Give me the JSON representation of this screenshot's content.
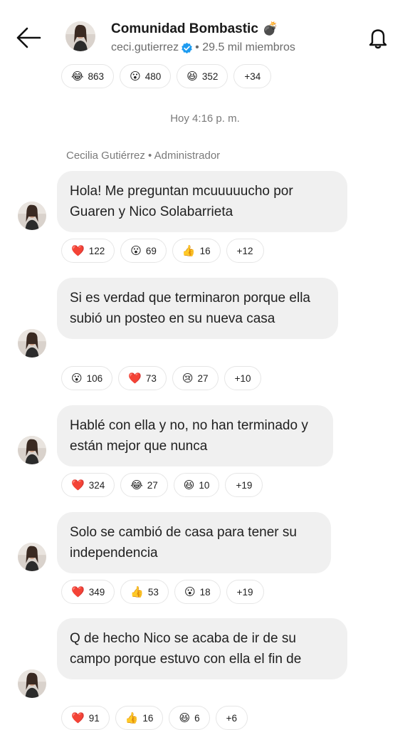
{
  "header": {
    "title": "Comunidad Bombastic",
    "title_emoji": "💣",
    "handle": "ceci.gutierrez",
    "members": "• 29.5 mil miembros"
  },
  "top_reactions": [
    {
      "emoji": "😂",
      "count": "863"
    },
    {
      "emoji": "😮",
      "count": "480"
    },
    {
      "emoji": "😆",
      "count": "352"
    },
    {
      "more": "+34"
    }
  ],
  "timestamp": "Hoy 4:16 p. m.",
  "sender": "Cecilia Gutiérrez • Administrador",
  "messages": [
    {
      "text": "Hola! Me preguntan mcuuuuucho por Guaren y Nico Solabarrieta",
      "reactions": [
        {
          "emoji": "❤️",
          "count": "122"
        },
        {
          "emoji": "😮",
          "count": "69"
        },
        {
          "emoji": "👍",
          "count": "16"
        },
        {
          "more": "+12"
        }
      ]
    },
    {
      "text": "Si es verdad que terminaron porque ella subió un posteo en su nueva casa",
      "reactions": [
        {
          "emoji": "😮",
          "count": "106"
        },
        {
          "emoji": "❤️",
          "count": "73"
        },
        {
          "emoji": "😢",
          "count": "27"
        },
        {
          "more": "+10"
        }
      ]
    },
    {
      "text": "Hablé con ella y no, no han terminado y están mejor que nunca",
      "reactions": [
        {
          "emoji": "❤️",
          "count": "324"
        },
        {
          "emoji": "😂",
          "count": "27"
        },
        {
          "emoji": "😆",
          "count": "10"
        },
        {
          "more": "+19"
        }
      ]
    },
    {
      "text": "Solo se cambió de casa para tener su independencia",
      "reactions": [
        {
          "emoji": "❤️",
          "count": "349"
        },
        {
          "emoji": "👍",
          "count": "53"
        },
        {
          "emoji": "😮",
          "count": "18"
        },
        {
          "more": "+19"
        }
      ]
    },
    {
      "text": "Q de hecho Nico se acaba de ir de su campo porque estuvo con ella el fin de",
      "reactions": [
        {
          "emoji": "❤️",
          "count": "91"
        },
        {
          "emoji": "👍",
          "count": "16"
        },
        {
          "emoji": "😆",
          "count": "6"
        },
        {
          "more": "+6"
        }
      ]
    }
  ],
  "icons": {
    "back": "arrow-left-icon",
    "bell": "bell-icon",
    "verified": "verified-badge-icon"
  },
  "colors": {
    "bubble": "#f0f0f0",
    "verified": "#1d9bf0",
    "heart": "#e0245e"
  }
}
